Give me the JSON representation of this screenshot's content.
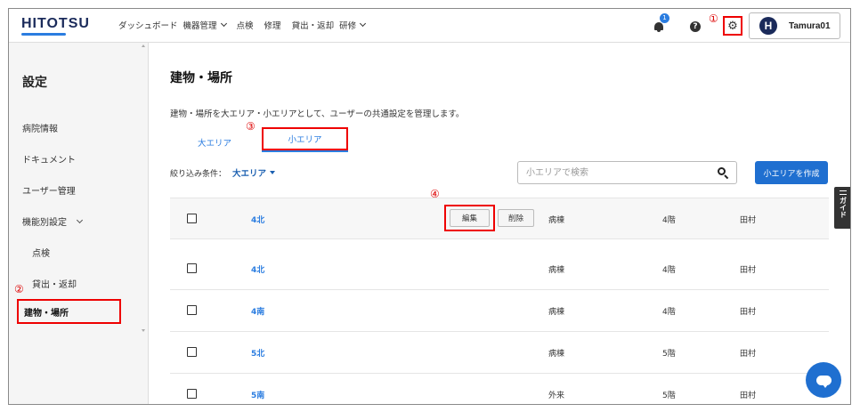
{
  "header": {
    "logo": "HITOTSU",
    "nav": [
      {
        "label": "ダッシュボード",
        "has_dropdown": false
      },
      {
        "label": "機器管理",
        "has_dropdown": true
      },
      {
        "label": "点検",
        "has_dropdown": false
      },
      {
        "label": "修理",
        "has_dropdown": false
      },
      {
        "label": "貸出・返却",
        "has_dropdown": false
      },
      {
        "label": "研修",
        "has_dropdown": true
      }
    ],
    "notification_count": "1",
    "help_icon": "?",
    "settings_icon": "gear-icon",
    "user": {
      "initial": "H",
      "name": "Tamura01"
    }
  },
  "annotations": {
    "a1": "①",
    "a2": "②",
    "a3": "③",
    "a4": "④"
  },
  "sidebar": {
    "title": "設定",
    "items": [
      {
        "label": "病院情報"
      },
      {
        "label": "ドキュメント"
      },
      {
        "label": "ユーザー管理"
      },
      {
        "label": "機能別設定"
      },
      {
        "label": "点検"
      },
      {
        "label": "貸出・返却"
      },
      {
        "label": "建物・場所"
      }
    ],
    "active_item": "建物・場所"
  },
  "main": {
    "title": "建物・場所",
    "description": "建物・場所を大エリア・小エリアとして、ユーザーの共通設定を管理します。",
    "tabs": [
      {
        "label": "大エリア",
        "active": false
      },
      {
        "label": "小エリア",
        "active": true
      }
    ],
    "filter_label": "絞り込み条件：",
    "filter_value": "大エリア",
    "search_placeholder": "小エリアで検索",
    "create_button": "小エリアを作成",
    "edit_button": "編集",
    "delete_button": "削除",
    "rows": [
      {
        "name": "4北",
        "type": "病棟",
        "floor": "4階",
        "user": "田村"
      },
      {
        "name": "4北",
        "type": "病棟",
        "floor": "4階",
        "user": "田村"
      },
      {
        "name": "4南",
        "type": "病棟",
        "floor": "4階",
        "user": "田村"
      },
      {
        "name": "5北",
        "type": "病棟",
        "floor": "5階",
        "user": "田村"
      },
      {
        "name": "5南",
        "type": "外来",
        "floor": "5階",
        "user": "田村"
      }
    ]
  },
  "guide": {
    "label": "ガイド"
  },
  "colors": {
    "accent": "#2b7de0",
    "primary_button": "#1f6fd0",
    "annotation": "#e00000",
    "brand": "#1a2a5a"
  }
}
